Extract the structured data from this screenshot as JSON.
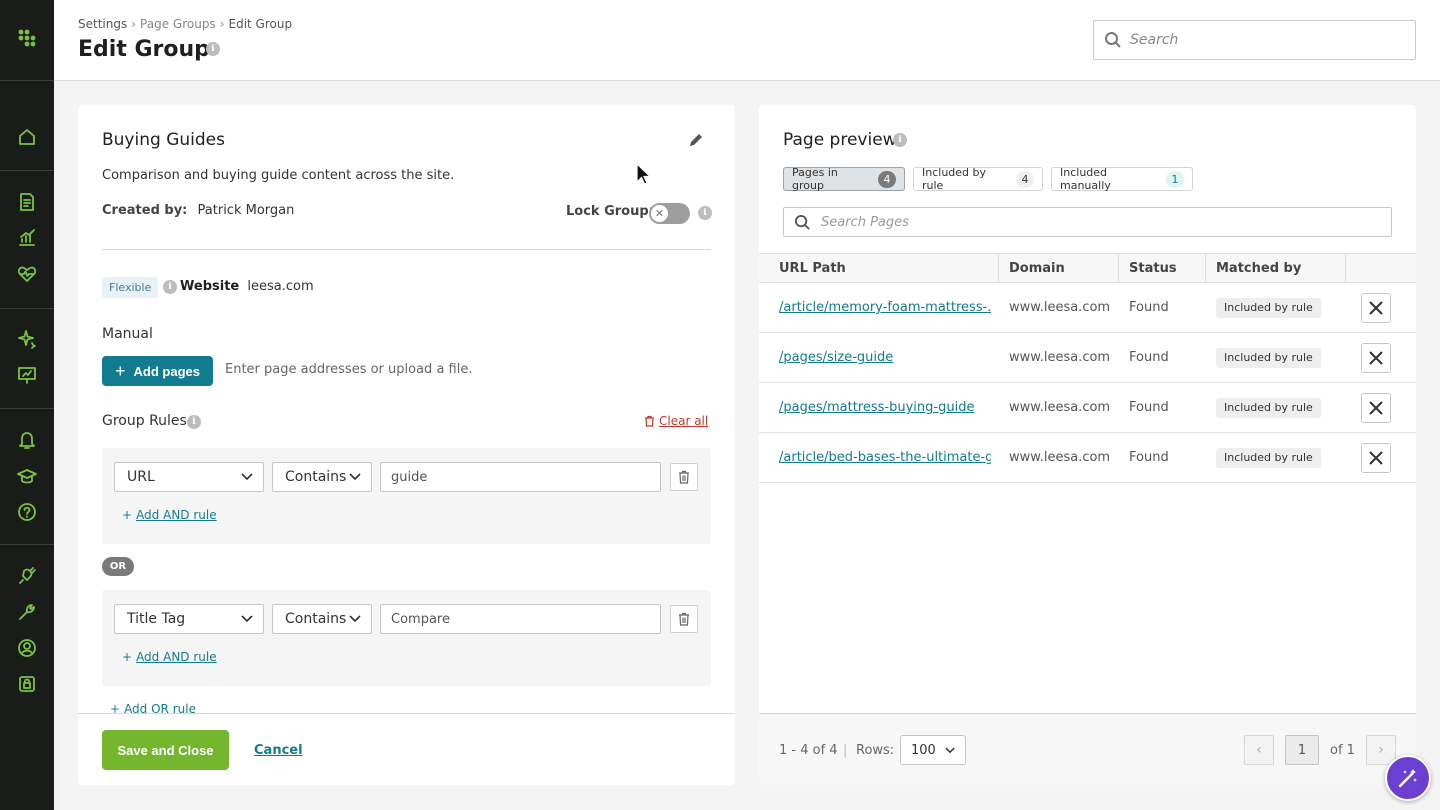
{
  "breadcrumb": [
    "Settings",
    "Page Groups",
    "Edit Group"
  ],
  "page_title": "Edit Group",
  "top_search": {
    "placeholder": "Search"
  },
  "sidebar": {
    "accent": "#7cc242",
    "icons": [
      "apps-grid-icon",
      "home-icon",
      "report-icon",
      "trend-chart-icon",
      "health-heart-icon",
      "sparkle-icon",
      "presentation-icon",
      "bell-icon",
      "graduation-cap-icon",
      "help-icon",
      "plug-icon",
      "wrench-icon",
      "user-circle-icon",
      "lock-icon"
    ]
  },
  "group": {
    "name": "Buying Guides",
    "description": "Comparison and buying guide content across the site.",
    "created_by_label": "Created by:",
    "created_by": "Patrick Morgan",
    "lock_label": "Lock Group:",
    "lock_on": false,
    "flex_badge": "Flexible",
    "website_label": "Website",
    "website": "leesa.com"
  },
  "manual": {
    "label": "Manual",
    "add_button": "Add pages",
    "hint": "Enter page addresses or upload a file."
  },
  "rules": {
    "label": "Group Rules",
    "clear_all": "Clear all",
    "or_label": "OR",
    "add_and": "Add AND rule",
    "add_or": "Add OR rule",
    "groups": [
      {
        "field": "URL",
        "operator": "Contains",
        "value": "guide"
      },
      {
        "field": "Title Tag",
        "operator": "Contains",
        "value": "Compare"
      }
    ]
  },
  "footer": {
    "save": "Save and Close",
    "cancel": "Cancel",
    "save_color": "#74b72e"
  },
  "preview": {
    "title": "Page preview",
    "chips": [
      {
        "label": "Pages in group",
        "count": "4"
      },
      {
        "label": "Included by rule",
        "count": "4"
      },
      {
        "label": "Included manually",
        "count": "1"
      }
    ],
    "search_placeholder": "Search Pages",
    "columns": [
      "URL Path",
      "Domain",
      "Status",
      "Matched by"
    ],
    "rows": [
      {
        "url": "/article/memory-foam-mattress-...",
        "domain": "www.leesa.com",
        "status": "Found",
        "matched": "Included by rule"
      },
      {
        "url": "/pages/size-guide",
        "domain": "www.leesa.com",
        "status": "Found",
        "matched": "Included by rule"
      },
      {
        "url": "/pages/mattress-buying-guide",
        "domain": "www.leesa.com",
        "status": "Found",
        "matched": "Included by rule"
      },
      {
        "url": "/article/bed-bases-the-ultimate-g...",
        "domain": "www.leesa.com",
        "status": "Found",
        "matched": "Included by rule"
      }
    ],
    "range": "1 - 4 of 4",
    "rows_label": "Rows:",
    "rows_value": "100",
    "page": "1",
    "page_of": "of 1",
    "link_color": "#137b8f"
  }
}
